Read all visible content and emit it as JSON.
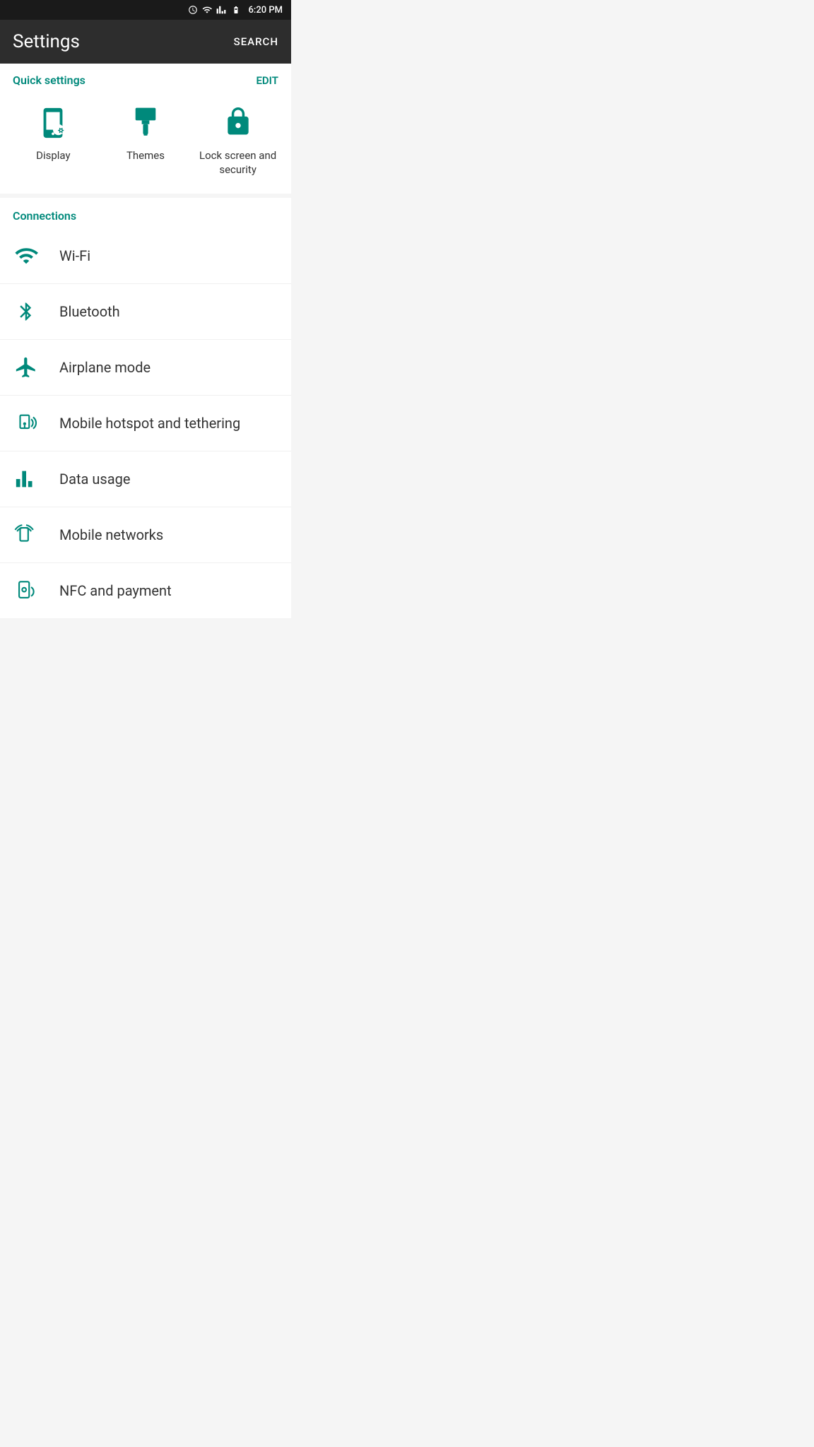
{
  "statusBar": {
    "time": "6:20 PM",
    "icons": [
      "alarm",
      "wifi",
      "signal",
      "battery"
    ]
  },
  "header": {
    "title": "Settings",
    "searchLabel": "SEARCH"
  },
  "quickSettings": {
    "sectionLabel": "Quick settings",
    "editLabel": "EDIT",
    "items": [
      {
        "id": "display",
        "label": "Display",
        "icon": "display"
      },
      {
        "id": "themes",
        "label": "Themes",
        "icon": "themes"
      },
      {
        "id": "lockscreen",
        "label": "Lock screen and security",
        "icon": "lock"
      }
    ]
  },
  "connections": {
    "sectionLabel": "Connections",
    "items": [
      {
        "id": "wifi",
        "label": "Wi-Fi",
        "icon": "wifi"
      },
      {
        "id": "bluetooth",
        "label": "Bluetooth",
        "icon": "bluetooth"
      },
      {
        "id": "airplane",
        "label": "Airplane mode",
        "icon": "airplane"
      },
      {
        "id": "hotspot",
        "label": "Mobile hotspot and tethering",
        "icon": "hotspot"
      },
      {
        "id": "data",
        "label": "Data usage",
        "icon": "data"
      },
      {
        "id": "networks",
        "label": "Mobile networks",
        "icon": "networks"
      },
      {
        "id": "nfc",
        "label": "NFC and payment",
        "icon": "nfc"
      }
    ]
  },
  "colors": {
    "teal": "#00897b",
    "darkBg": "#2d2d2d",
    "statusBg": "#1a1a1a"
  }
}
